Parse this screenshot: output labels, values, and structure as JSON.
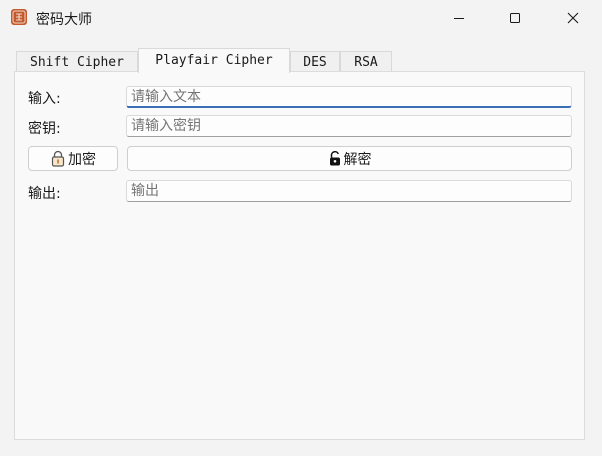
{
  "window": {
    "title": "密码大师",
    "icon": "app-seal-icon",
    "controls": {
      "minimize": "minimize-icon",
      "maximize": "maximize-icon",
      "close": "close-icon"
    }
  },
  "tabs": [
    {
      "label": "Shift Cipher",
      "selected": false
    },
    {
      "label": "Playfair Cipher",
      "selected": true
    },
    {
      "label": "DES",
      "selected": false
    },
    {
      "label": "RSA",
      "selected": false
    }
  ],
  "form": {
    "input_label": "输入:",
    "input_placeholder": "请输入文本",
    "input_value": "",
    "key_label": "密钥:",
    "key_placeholder": "请输入密钥",
    "key_value": "",
    "encrypt_button": "加密",
    "encrypt_icon": "lock-icon",
    "decrypt_button": "解密",
    "decrypt_icon": "unlock-icon",
    "output_label": "输出:",
    "output_placeholder": "输出",
    "output_value": ""
  },
  "colors": {
    "focus_accent": "#3a6fb7",
    "icon_accent": "#c25a2e"
  }
}
